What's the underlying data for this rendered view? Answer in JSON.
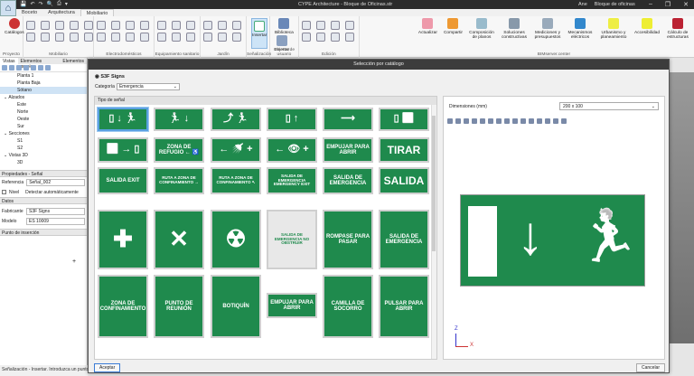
{
  "window": {
    "title": "CYPE Architecture - Bloque de Oficinas.str",
    "user": "Ane",
    "project": "Bloque de oficinas"
  },
  "ribbon": {
    "tabs": [
      "Boceto",
      "Arquitectura",
      "Mobiliario"
    ],
    "active_tab": "Mobiliario",
    "groups": [
      {
        "label": "Proyecto",
        "buttons": [
          "Catálogos"
        ]
      },
      {
        "label": "Mobiliario"
      },
      {
        "label": "Electrodomésticos"
      },
      {
        "label": "Equipamiento sanitario"
      },
      {
        "label": "Jardín"
      },
      {
        "label": "Señalización",
        "buttons": [
          "Insertar"
        ]
      },
      {
        "label": "Objetos de usuario",
        "buttons": [
          "Biblioteca",
          "Insertar"
        ]
      },
      {
        "label": "Edición"
      },
      {
        "label": "BIMserver.center",
        "buttons": [
          "Actualizar",
          "Compartir",
          "Composición de planos",
          "Soluciones constructivas",
          "Mediciones y presupuestos",
          "Mecanismos eléctricos",
          "Urbanismo y planeamiento",
          "Accesibilidad",
          "Cálculo de estructuras"
        ]
      }
    ]
  },
  "left_panel": {
    "tabs": [
      "Vistas",
      "Elementos propios",
      "Elementos"
    ],
    "tree": [
      {
        "label": "Planta 1",
        "level": 2
      },
      {
        "label": "Planta Baja",
        "level": 2
      },
      {
        "label": "Sótano",
        "level": 2,
        "selected": true
      },
      {
        "label": "Alzados",
        "level": 1
      },
      {
        "label": "Este",
        "level": 2
      },
      {
        "label": "Norte",
        "level": 2
      },
      {
        "label": "Oeste",
        "level": 2
      },
      {
        "label": "Sur",
        "level": 2
      },
      {
        "label": "Secciones",
        "level": 1
      },
      {
        "label": "S1",
        "level": 2
      },
      {
        "label": "S2",
        "level": 2
      },
      {
        "label": "Vistas 3D",
        "level": 1
      },
      {
        "label": "3D",
        "level": 2
      }
    ],
    "properties_title": "Propiedades - Señal",
    "referencia_label": "Referencia",
    "referencia_value": "Señal_002",
    "nivel_label": "Nivel",
    "nivel_auto": "Detectar automáticamente",
    "datos_title": "Datos",
    "fabricante_label": "Fabricante",
    "fabricante_value": "S3F Signs",
    "modelo_label": "Modelo",
    "modelo_value": "ES 10009",
    "insert_point_title": "Punto de inserción"
  },
  "status": "Señalización - Insertar. Introduzca un punto.",
  "dialog": {
    "title": "Selección por catálogo",
    "manufacturer": "S3F Signs",
    "category_label": "Categoría",
    "category_value": "Emergencia",
    "grid_title": "Tipo de señal",
    "dimensions_label": "Dimensiones (mm)",
    "dimensions_value": "200 x 100",
    "accept": "Aceptar",
    "cancel": "Cancelar",
    "brand_color": "#1f8a4d",
    "signs": [
      {
        "text": "▯ ↓ 🏃",
        "icon": "exit-door-runner-icon",
        "selected": true
      },
      {
        "text": "🏃 ↓",
        "icon": "runner-arrow-down-icon"
      },
      {
        "text": "⤴ 🏃",
        "icon": "stairs-runner-icon"
      },
      {
        "text": "▯ ↑",
        "icon": "door-arrow-up-icon"
      },
      {
        "text": "⟶",
        "icon": "arrow-right-icon"
      },
      {
        "text": "▯ ♿",
        "icon": "door-wheelchair-icon"
      },
      {
        "text": "♿ → ▯",
        "icon": "wheelchair-arrow-door-icon"
      },
      {
        "text": "ZONA DE REFUGIO ← ♿"
      },
      {
        "text": "← 🚿 +",
        "icon": "emergency-shower-icon"
      },
      {
        "text": "← 👁 +",
        "icon": "eye-wash-icon"
      },
      {
        "text": "EMPUJAR PARA ABRIR"
      },
      {
        "text": "TIRAR"
      },
      {
        "text": "SALIDA EXIT"
      },
      {
        "text": "RUTA A ZONA DE CONFINAMIENTO →"
      },
      {
        "text": "RUTA A ZONA DE CONFINAMIENTO ↖"
      },
      {
        "text": "SALIDA DE EMERGENCIA EMERGENCY EXIT"
      },
      {
        "text": "SALIDA DE EMERGENCIA"
      },
      {
        "text": "SALIDA"
      },
      {
        "text": "✚",
        "icon": "first-aid-cross-icon"
      },
      {
        "text": "✕",
        "icon": "assembly-point-arrows-icon"
      },
      {
        "text": "☢",
        "icon": "gas-mask-icon"
      },
      {
        "text": "SALIDA DE EMERGENCIA NO OBSTRUIR"
      },
      {
        "text": "ROMPASE PARA PASAR"
      },
      {
        "text": "SALIDA DE EMERGENCIA"
      },
      {
        "text": "ZONA DE CONFINAMIENTO"
      },
      {
        "text": "PUNTO DE REUNIÓN"
      },
      {
        "text": "BOTIQUÍN"
      },
      {
        "text": "EMPUJAR PARA ABRIR"
      },
      {
        "text": "CAMILLA DE SOCORRO"
      },
      {
        "text": "PULSAR PARA ABRIR"
      }
    ],
    "preview": {
      "arrow": "↓",
      "runner": "🏃",
      "axis_x": "X",
      "axis_z": "Z"
    }
  }
}
